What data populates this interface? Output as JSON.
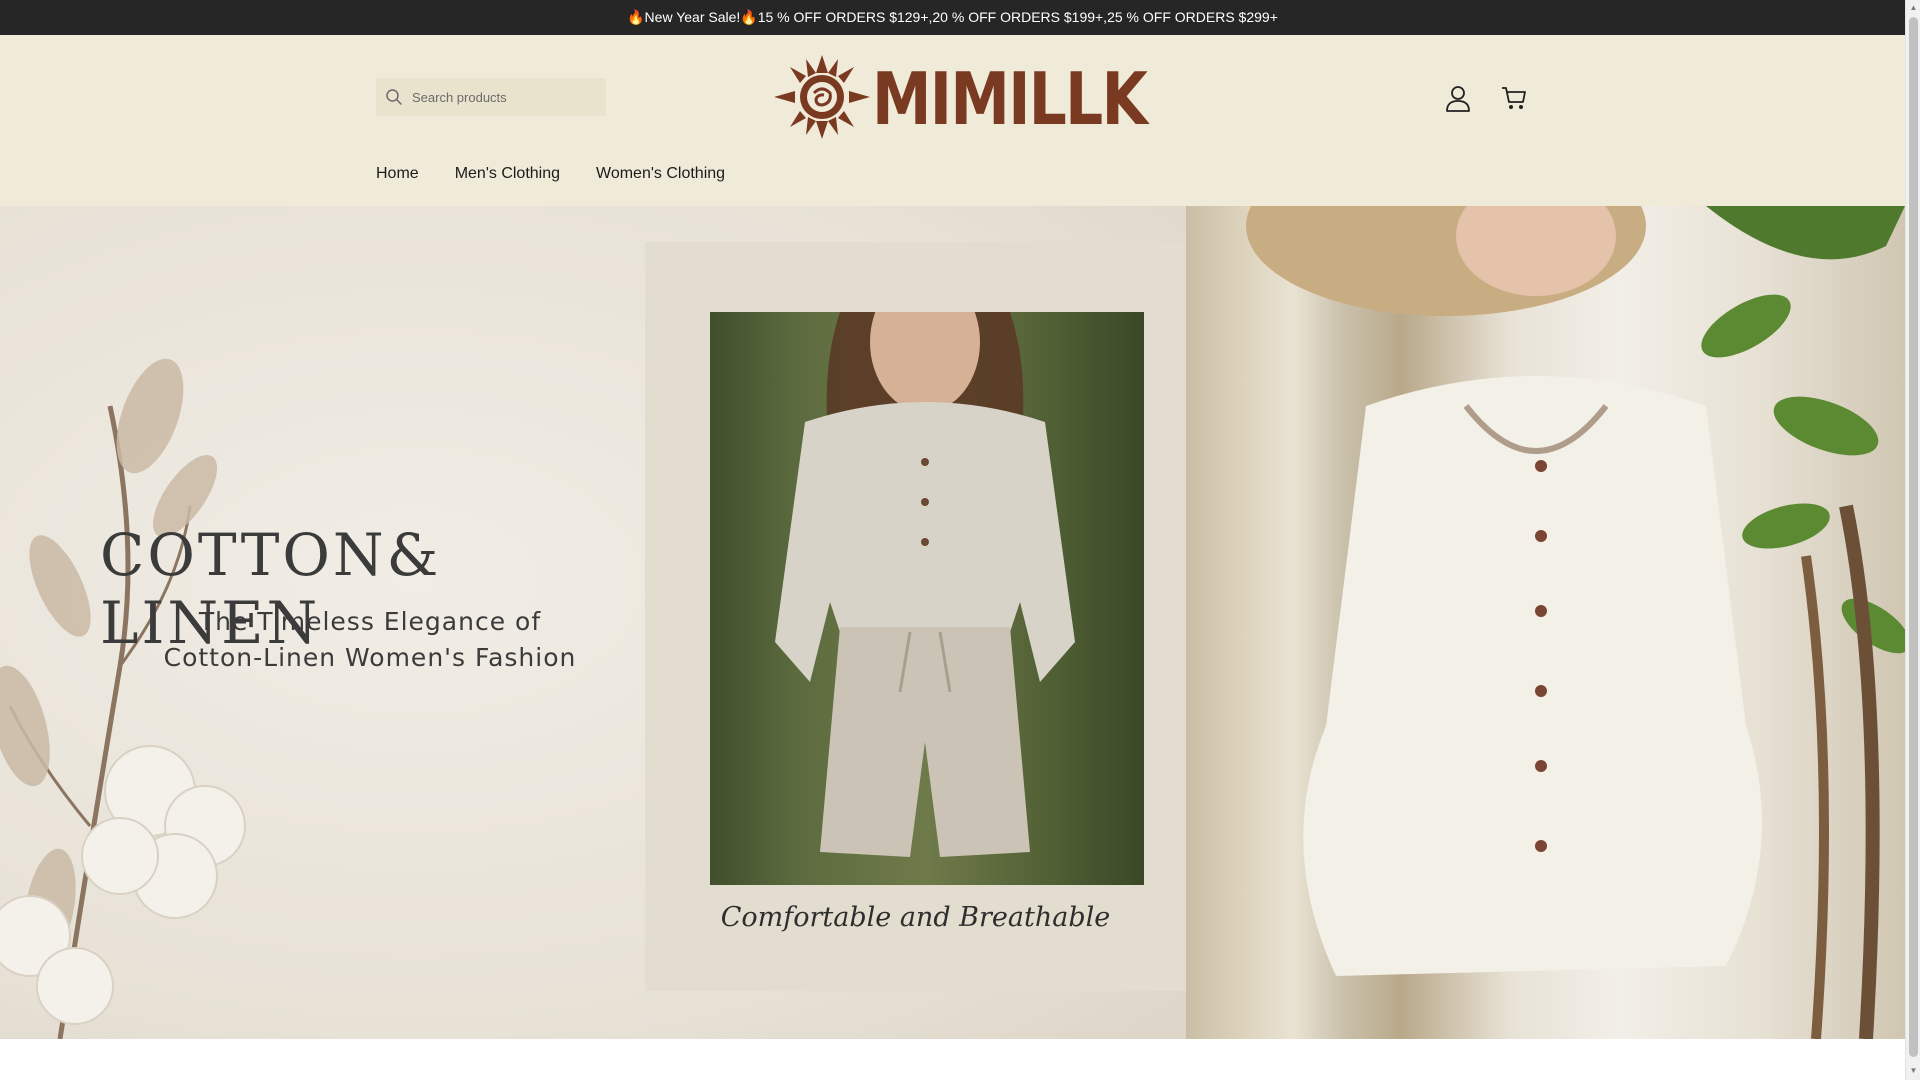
{
  "announcement": {
    "text": "🔥New Year Sale!🔥15 % OFF ORDERS $129+,20 % OFF ORDERS $199+,25 % OFF ORDERS $299+"
  },
  "header": {
    "search_placeholder": "Search products",
    "logo_text": "MIMILLK",
    "account_icon": "user-icon",
    "cart_icon": "cart-icon",
    "search_icon": "search-icon"
  },
  "nav": {
    "items": [
      {
        "label": "Home"
      },
      {
        "label": "Men's Clothing"
      },
      {
        "label": "Women's Clothing"
      }
    ]
  },
  "hero": {
    "title": "COTTON& LINEN",
    "subtitle_line1": "The Timeless Elegance of",
    "subtitle_line2": "Cotton-Linen Women's Fashion",
    "caption": "Comfortable and Breathable"
  },
  "colors": {
    "announcement_bg": "#262626",
    "header_bg": "#f0ead8",
    "brand": "#7a3a22",
    "text": "#1c1c1c"
  }
}
